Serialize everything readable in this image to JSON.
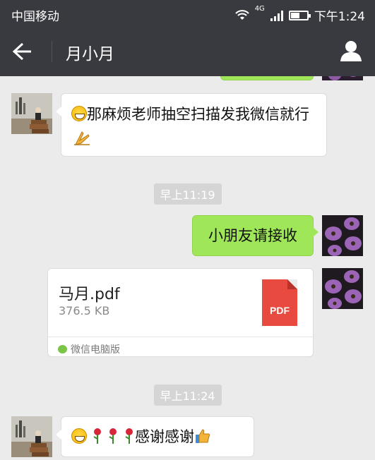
{
  "status_bar": {
    "carrier": "中国移动",
    "network": "4G",
    "time": "下午1:24"
  },
  "header": {
    "title": "月小月"
  },
  "messages": {
    "m1": {
      "text": "那麻烦老师抽空扫描发我微信就行"
    },
    "ts1": "早上11:19",
    "m2": {
      "text": "小朋友请接收"
    },
    "file": {
      "name": "马月.pdf",
      "size": "376.5 KB",
      "type_label": "PDF",
      "source": "微信电脑版"
    },
    "ts2": "早上11:24",
    "m3": {
      "text": "感谢感谢"
    }
  },
  "colors": {
    "bar_bg": "#393a3f",
    "chat_bg": "#ebebeb",
    "sent_bubble": "#9fe658",
    "pdf_red": "#e94a3f"
  }
}
